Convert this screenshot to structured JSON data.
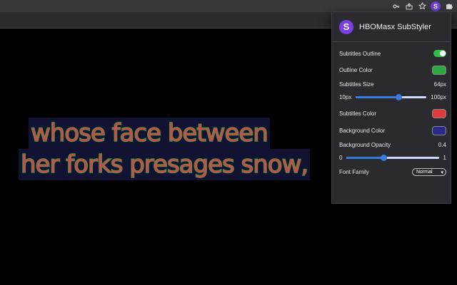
{
  "subtitles": {
    "line1": "whose face between",
    "line2": "her forks presages snow,"
  },
  "popup": {
    "title": "HBOMasx SubStyler",
    "logo_letter": "S",
    "outline_label": "Subtitles Outline",
    "outline_enabled": true,
    "outline_color_label": "Outline Color",
    "outline_color": "#2da73f",
    "size_label": "Subtitles Size",
    "size_value": "64px",
    "size_min": "10px",
    "size_max": "100px",
    "size_fraction": 0.6,
    "color_label": "Subtitles Color",
    "subtitle_color": "#e03a3a",
    "bg_color_label": "Background Color",
    "bg_color": "#2a2a8a",
    "bg_opacity_label": "Background Opacity",
    "bg_opacity_value": "0.4",
    "opacity_min": "0",
    "opacity_max": "1",
    "opacity_fraction": 0.4,
    "font_family_label": "Font Family",
    "font_family_value": "Normal"
  },
  "toolbar": {
    "extension_letter": "S",
    "icons": [
      "key-icon",
      "share-icon",
      "star-icon",
      "extension-icon",
      "puzzle-icon"
    ]
  }
}
